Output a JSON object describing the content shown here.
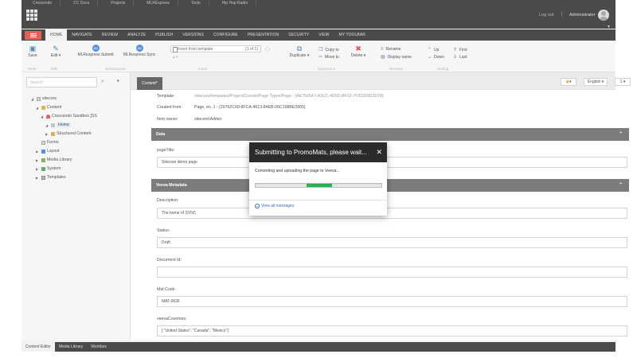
{
  "browser_tabs": [
    "Crescendo",
    "CC Docs",
    "Projects",
    "MLRExpress",
    "Tools",
    "Hip Hop Radio"
  ],
  "header": {
    "logout": "Log out",
    "separator": "|",
    "user": "Administrator"
  },
  "ribbon_tabs": [
    "HOME",
    "NAVIGATE",
    "REVIEW",
    "ANALYZE",
    "PUBLISH",
    "VERSIONS",
    "CONFIGURE",
    "PRESENTATION",
    "SECURITY",
    "VIEW",
    "MY TOOLBAR"
  ],
  "ribbon": {
    "save": "Save",
    "edit": "Edit",
    "mlr_submit": "MLRexpress Submit",
    "mlr_sync": "MLRexpress Sync",
    "mlr_badge": "3M",
    "insert_from_template": "Insert from template",
    "template_count": "(1 of 1)",
    "duplicate": "Duplicate",
    "copy_to": "Copy to",
    "move_to": "Move to",
    "delete": "Delete",
    "rename": "Rename",
    "display_name": "Display name",
    "up": "Up",
    "down": "Down",
    "first": "First",
    "last": "Last",
    "groups": {
      "write": "Write",
      "edit": "Edit",
      "mlr": "MLRexpress",
      "insert": "Insert",
      "operations": "Operations",
      "rename": "Rename",
      "sorting": "Sorting"
    }
  },
  "sidebar": {
    "search_placeholder": "Search",
    "tree": {
      "sitecore": "sitecore",
      "content": "Content",
      "sandbox": "Crescendo Sandbox [SS",
      "home": "Home",
      "structured": "Structured Content",
      "forms": "Forms",
      "layout": "Layout",
      "media": "Media Library",
      "system": "System",
      "templates": "Templates"
    }
  },
  "main": {
    "content_tab": "Content*",
    "language": "English",
    "version": "1",
    "template_label": "Template:",
    "template_value": "/sitecore/templates/Project/Crendo/Page Types/Page - {AE7505A7-A3CC-4D5D-BF02-7F32209D3D78}",
    "created_from_label": "Created from:",
    "created_from_value": "Page, en, 1 - {20762C60-8FCA-4613-84EB-06C198BE3905}",
    "item_owner_label": "Item owner:",
    "item_owner_value": "sitecore\\Admin",
    "data_section": "Data",
    "pagetitle_label": "pageTitle:",
    "pagetitle_value": "Sitecore demo page",
    "veeva_section": "Veeva Metadata",
    "description_label": "Description:",
    "description_value": "The home of SYNC",
    "status_label": "Status:",
    "status_value": "Draft",
    "docid_label": "Document Id:",
    "docid_value": "",
    "matcode_label": "Mat Code:",
    "matcode_value": "MAT-0636",
    "countries_label": "veevaCountries:",
    "countries_value": "[ \"United States\", \"Canada\", \"Mexico\"]"
  },
  "bottom_tabs": [
    "Content Editor",
    "Media Library",
    "Workbox"
  ],
  "dialog": {
    "title": "Submitting to PromoMats, please wait...",
    "close": "✕",
    "message": "Converting and uploading the page to Veeva...",
    "link": "View all messages",
    "progress": 0.4
  },
  "colors": {
    "accent_red": "#e0453a",
    "dark_bar": "#2b2b2b",
    "progress_green": "#27b44a",
    "section_gray": "#666666"
  }
}
